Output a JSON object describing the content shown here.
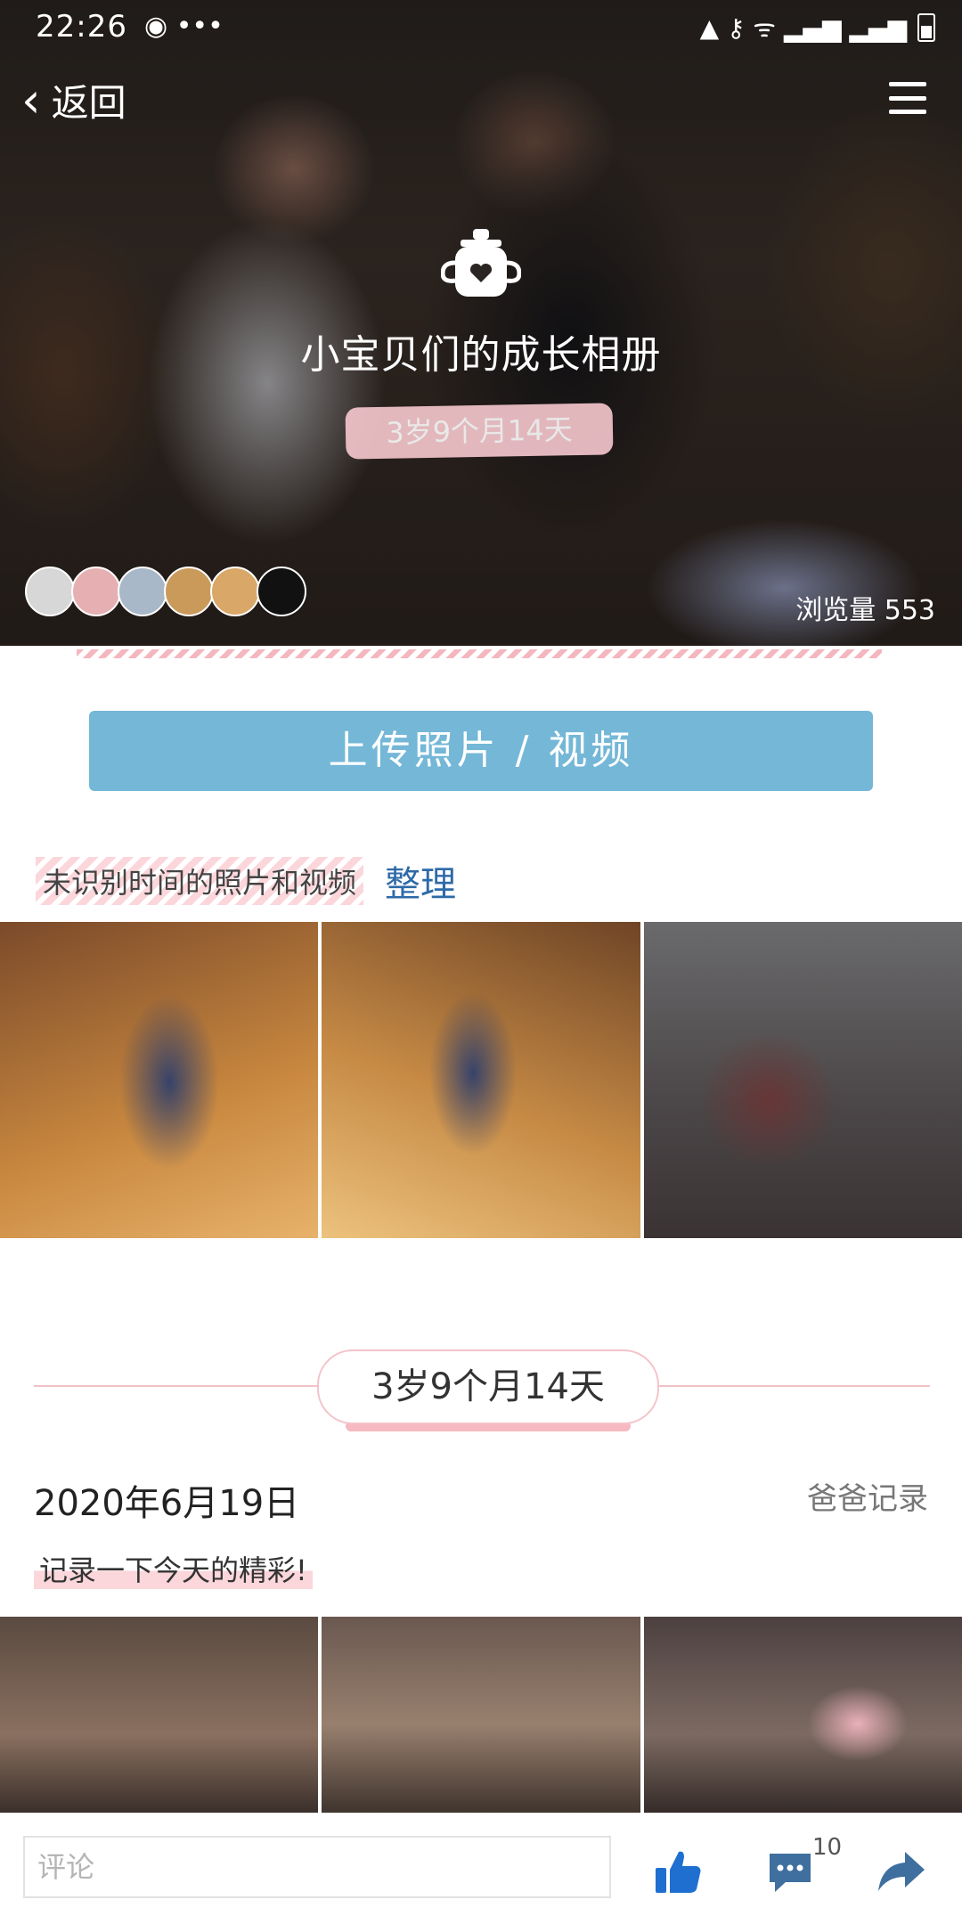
{
  "status_bar": {
    "time": "22:26",
    "left_icons": "◉ •••",
    "right_icons": "▲ ⚷ ᯤ ▂▄▆ ▂▄▆"
  },
  "nav": {
    "back_label": "返回"
  },
  "album": {
    "title": "小宝贝们的成长相册",
    "age": "3岁9个月14天",
    "views": "浏览量 553"
  },
  "upload": {
    "label": "上传照片 / 视频"
  },
  "unidentified": {
    "label": "未识别时间的照片和视频",
    "organize": "整理"
  },
  "timeline": {
    "age": "3岁9个月14天",
    "date": "2020年6月19日",
    "author": "爸爸记录",
    "text": "记录一下今天的精彩!"
  },
  "bottom_bar": {
    "comment_placeholder": "评论",
    "comment_count": "10"
  },
  "colors": {
    "upload_button": "#74b7d7",
    "link": "#2d6aa8",
    "pink_accent": "#f4c3ca"
  }
}
